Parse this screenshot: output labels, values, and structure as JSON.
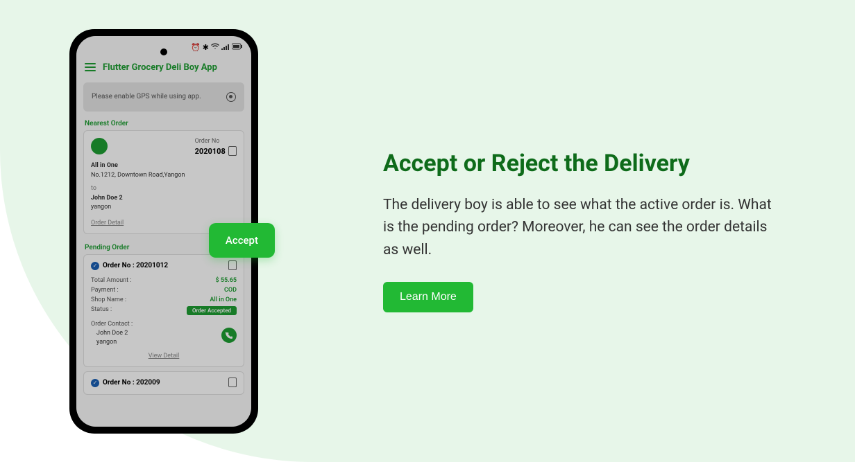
{
  "statusBar": {
    "alarm": "⏰",
    "bluetooth": "✱",
    "wifi": "≋",
    "signal": "⫿⫿",
    "battery": "▭"
  },
  "app": {
    "title": "Flutter Grocery Deli Boy  App",
    "gpsMessage": "Please enable GPS while using app."
  },
  "nearestOrder": {
    "sectionLabel": "Nearest Order",
    "orderNoLabel": "Order No",
    "orderNo": "2020108",
    "shopName": "All in One",
    "shopAddress": "No.1212, Downtown Road,Yangon",
    "to": "to",
    "customerName": "John Doe 2",
    "customerCity": "yangon",
    "detailLink": "Order Detail"
  },
  "pendingOrder": {
    "sectionLabel": "Pending Order",
    "orderNoPrefix": "Order No :",
    "orderNo": "20201012",
    "rows": [
      {
        "label": "Total Amount  :",
        "value": "$ 55.65"
      },
      {
        "label": "Payment :",
        "value": "COD"
      },
      {
        "label": "Shop Name :",
        "value": "All in One"
      }
    ],
    "statusLabel": "Status :",
    "statusValue": "Order Accepted",
    "contactLabel": "Order Contact :",
    "contactName": "John Doe 2",
    "contactCity": "yangon",
    "viewDetail": "View Detail"
  },
  "secondOrder": {
    "orderNoPrefix": "Order No :",
    "orderNo": "202009"
  },
  "acceptButton": "Accept",
  "marketing": {
    "heading": "Accept or Reject the Delivery",
    "body": "The delivery boy is able to see what the active order is. What is the pending order? Moreover, he can see the order details as well.",
    "cta": "Learn More"
  }
}
